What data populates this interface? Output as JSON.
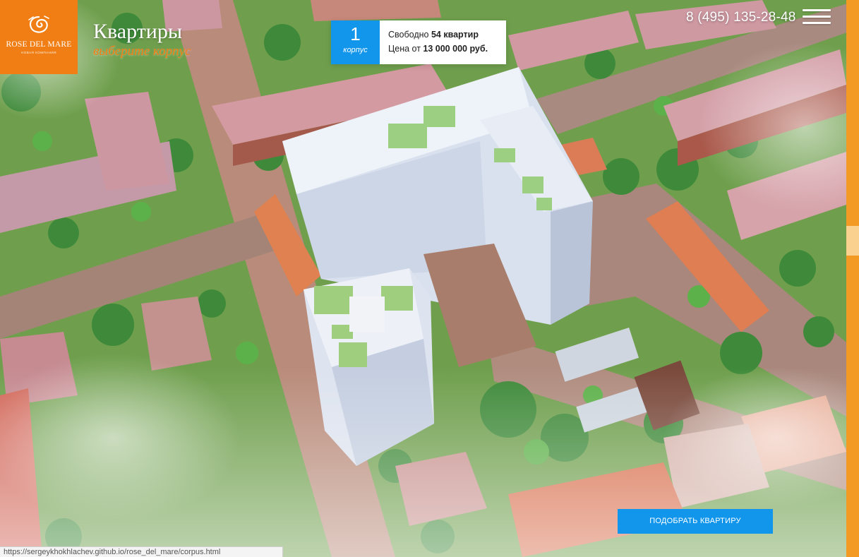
{
  "brand": {
    "name": "ROSE DEL MARE",
    "tagline": "НОВАЯ КОМПАНИЯ",
    "logo_color": "#f07e14"
  },
  "header": {
    "title": "Квартиры",
    "subtitle": "выберите корпус",
    "phone": "8 (495) 135-28-48",
    "menu_icon": "hamburger-icon"
  },
  "building_card": {
    "number": "1",
    "label": "корпус",
    "free_prefix": "Свободно ",
    "free_count": "54 квартир",
    "price_prefix": "Цена от ",
    "price": "13 000 000 руб.",
    "accent": "#1196ec"
  },
  "cta": {
    "label": "ПОДОБРАТЬ КВАРТИРУ"
  },
  "status_bar": {
    "url": "https://sergeykhokhlachev.github.io/rose_del_mare/corpus.html"
  },
  "colors": {
    "orange": "#f07e14",
    "blue": "#1196ec"
  }
}
